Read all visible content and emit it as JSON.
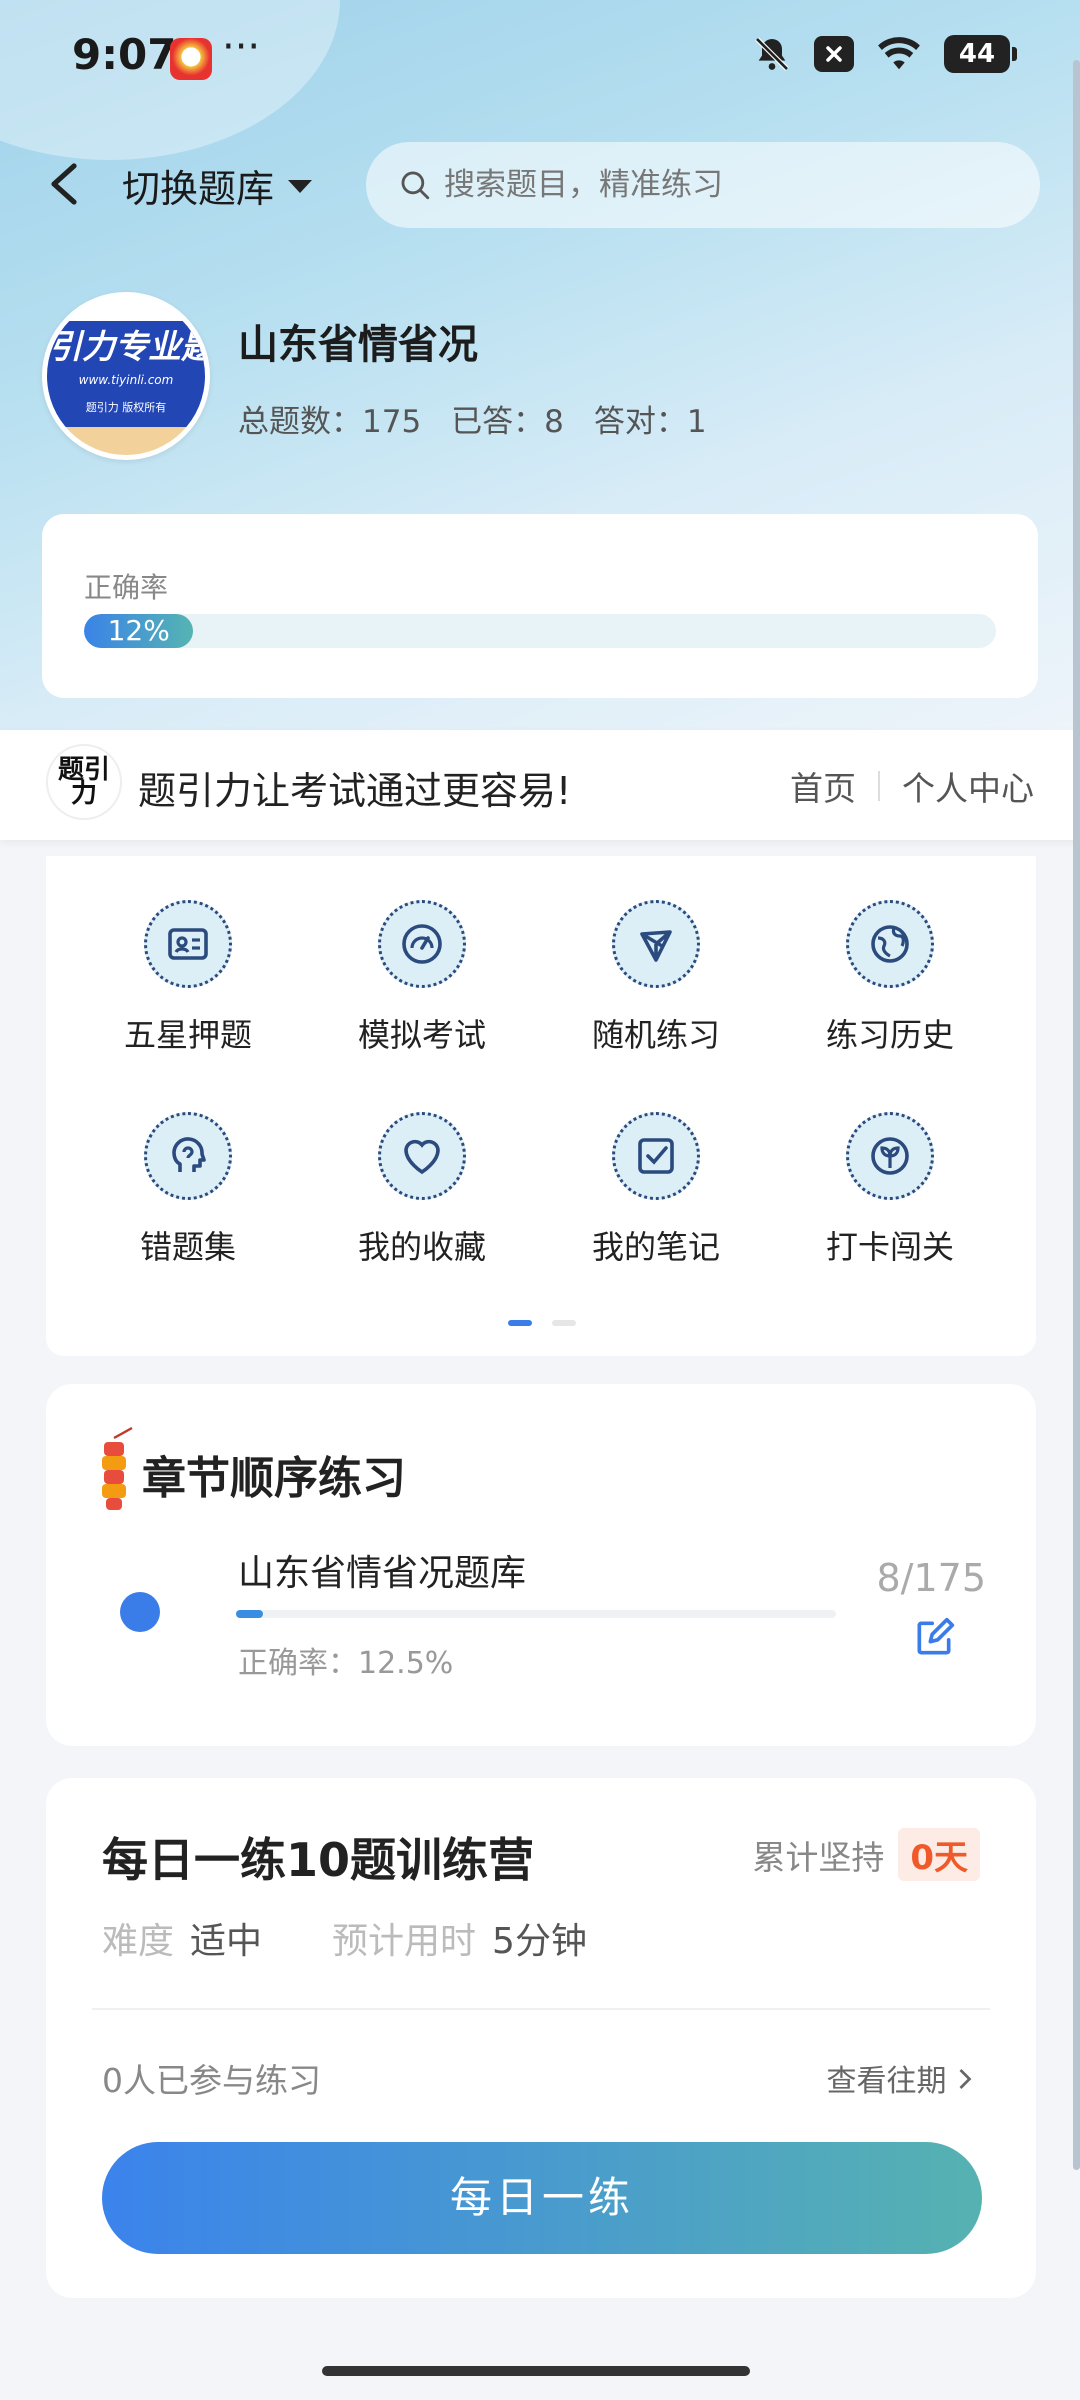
{
  "status_bar": {
    "time": "9:07",
    "dots": "···",
    "battery": "44"
  },
  "header": {
    "switch_label": "切换题库",
    "search_placeholder": "搜索题目，精准练习"
  },
  "bank": {
    "logo_band_text": "引力专业题",
    "logo_url_text": "www.tiyinli.com",
    "logo_sub_text": "题引力 版权所有",
    "name": "山东省情省况",
    "stats": [
      {
        "label": "总题数：",
        "value": "175"
      },
      {
        "label": "已答：",
        "value": "8"
      },
      {
        "label": "答对：",
        "value": "1"
      }
    ]
  },
  "accuracy": {
    "label": "正确率",
    "percent_text": "12%",
    "percent": 12
  },
  "banner": {
    "logo_text": "题引力",
    "slogan": "题引力让考试通过更容易!",
    "nav_home": "首页",
    "nav_profile": "个人中心"
  },
  "grid": [
    {
      "label": "五星押题",
      "icon": "id-card-icon"
    },
    {
      "label": "模拟考试",
      "icon": "speedometer-icon"
    },
    {
      "label": "随机练习",
      "icon": "network-icon"
    },
    {
      "label": "练习历史",
      "icon": "globe-icon"
    },
    {
      "label": "错题集",
      "icon": "head-icon"
    },
    {
      "label": "我的收藏",
      "icon": "heart-icon"
    },
    {
      "label": "我的笔记",
      "icon": "note-check-icon"
    },
    {
      "label": "打卡闯关",
      "icon": "leaf-icon"
    }
  ],
  "chapter": {
    "title": "章节顺序练习",
    "bank_name": "山东省情省况题库",
    "accuracy_text": "正确率：12.5%",
    "count_text": "8/175",
    "progress": 0.0457
  },
  "daily": {
    "title": "每日一练10题训练营",
    "persist_label": "累计坚持",
    "days": "0天",
    "difficulty_label": "难度",
    "difficulty_value": "适中",
    "time_label": "预计用时",
    "time_value": "5分钟",
    "participants": "0人已参与练习",
    "history_link": "查看往期",
    "button": "每日一练"
  },
  "colors": {
    "accent": "#3a7de8",
    "accent_teal": "#56b2b1",
    "badge_orange": "#f05a2a"
  }
}
